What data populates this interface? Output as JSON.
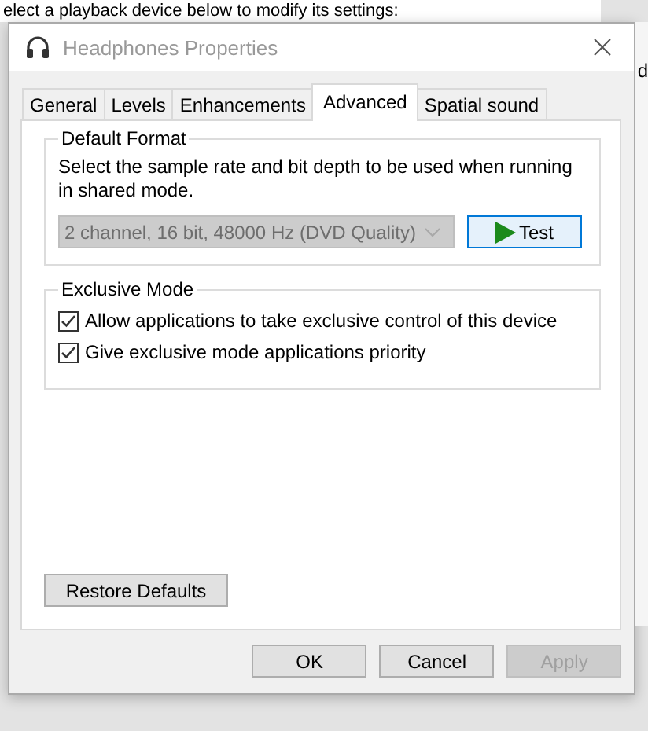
{
  "background": {
    "text": "elect a playback device below to modify its settings:",
    "edge_text": "d"
  },
  "window": {
    "title": "Headphones Properties",
    "active": false
  },
  "tabs": [
    {
      "label": "General",
      "selected": false
    },
    {
      "label": "Levels",
      "selected": false
    },
    {
      "label": "Enhancements",
      "selected": false
    },
    {
      "label": "Advanced",
      "selected": true
    },
    {
      "label": "Spatial sound",
      "selected": false
    }
  ],
  "default_format": {
    "title": "Default Format",
    "description": "Select the sample rate and bit depth to be used when running in shared mode.",
    "format": {
      "value": "2 channel, 16 bit, 48000 Hz (DVD Quality)",
      "disabled": true
    },
    "test_button": "Test"
  },
  "exclusive_mode": {
    "title": "Exclusive Mode",
    "options": [
      {
        "label": "Allow applications to take exclusive control of this device",
        "checked": true
      },
      {
        "label": "Give exclusive mode applications priority",
        "checked": true
      }
    ]
  },
  "restore_button": "Restore Defaults",
  "buttons": [
    {
      "label": "OK",
      "disabled": false
    },
    {
      "label": "Cancel",
      "disabled": false
    },
    {
      "label": "Apply",
      "disabled": true
    }
  ]
}
